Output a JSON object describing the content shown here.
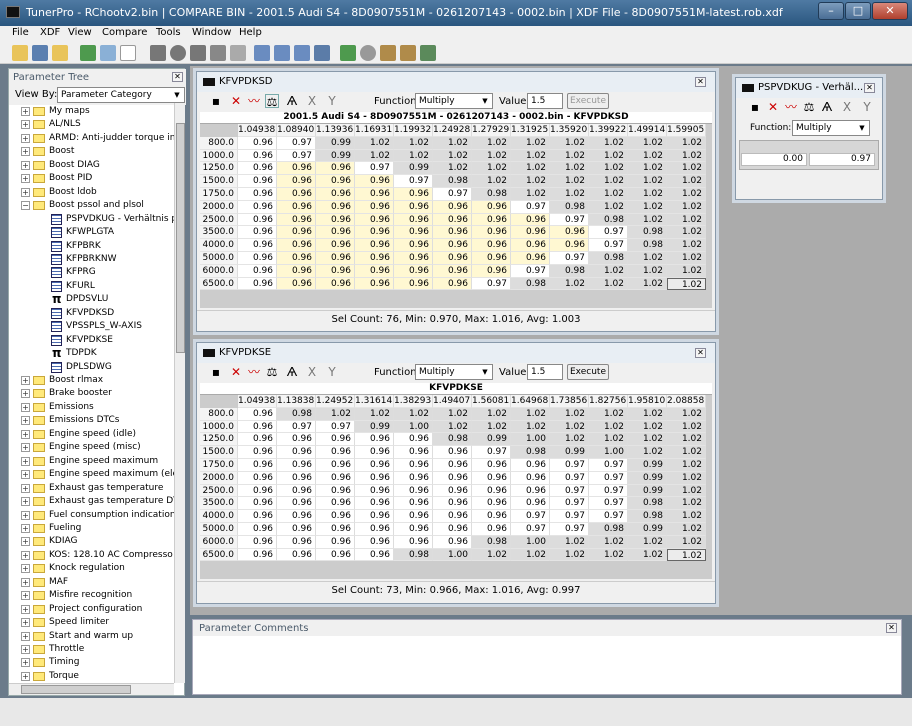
{
  "app": {
    "title": "TunerPro - RChootv2.bin | COMPARE BIN - 2001.5 Audi S4 - 8D0907551M - 0261207143 - 0002.bin | XDF File - 8D0907551M-latest.rob.xdf"
  },
  "menu": [
    "File",
    "XDF",
    "View",
    "Compare",
    "Tools",
    "Window",
    "Help"
  ],
  "tree": {
    "header": "Parameter Tree",
    "viewby_label": "View By:",
    "viewby_value": "Parameter Category",
    "items": [
      {
        "label": "My maps",
        "kind": "folder"
      },
      {
        "label": "AL/NLS",
        "kind": "folder"
      },
      {
        "label": "ARMD: Anti-judder torque inte",
        "kind": "folder"
      },
      {
        "label": "Boost",
        "kind": "folder"
      },
      {
        "label": "Boost DIAG",
        "kind": "folder"
      },
      {
        "label": "Boost PID",
        "kind": "folder"
      },
      {
        "label": "Boost ldob",
        "kind": "folder"
      },
      {
        "label": "Boost pssol and plsol",
        "kind": "folder-open"
      },
      {
        "label": "PSPVDKUG - Verhältnis psp",
        "kind": "table"
      },
      {
        "label": "KFWPLGTA",
        "kind": "table"
      },
      {
        "label": "KFPBRK",
        "kind": "table"
      },
      {
        "label": "KFPBRKNW",
        "kind": "table"
      },
      {
        "label": "KFPRG",
        "kind": "table"
      },
      {
        "label": "KFURL",
        "kind": "table"
      },
      {
        "label": "DPDSVLU",
        "kind": "pi"
      },
      {
        "label": "KFVPDKSD",
        "kind": "table"
      },
      {
        "label": "VPSSPLS_W-AXIS",
        "kind": "table"
      },
      {
        "label": "KFVPDKSE",
        "kind": "table"
      },
      {
        "label": "TDPDK",
        "kind": "pi"
      },
      {
        "label": "DPLSDWG",
        "kind": "table"
      },
      {
        "label": "Boost rlmax",
        "kind": "folder"
      },
      {
        "label": "Brake booster",
        "kind": "folder"
      },
      {
        "label": "Emissions",
        "kind": "folder"
      },
      {
        "label": "Emissions DTCs",
        "kind": "folder"
      },
      {
        "label": "Engine speed (idle)",
        "kind": "folder"
      },
      {
        "label": "Engine speed (misc)",
        "kind": "folder"
      },
      {
        "label": "Engine speed maximum",
        "kind": "folder"
      },
      {
        "label": "Engine speed maximum (eleva",
        "kind": "folder"
      },
      {
        "label": "Exhaust gas temperature",
        "kind": "folder"
      },
      {
        "label": "Exhaust gas temperature DTC",
        "kind": "folder"
      },
      {
        "label": "Fuel consumption indication",
        "kind": "folder"
      },
      {
        "label": "Fueling",
        "kind": "folder"
      },
      {
        "label": "KDIAG",
        "kind": "folder"
      },
      {
        "label": "KOS: 128.10   AC Compresso",
        "kind": "folder"
      },
      {
        "label": "Knock regulation",
        "kind": "folder"
      },
      {
        "label": "MAF",
        "kind": "folder"
      },
      {
        "label": "Misfire recognition",
        "kind": "folder"
      },
      {
        "label": "Project configuration",
        "kind": "folder"
      },
      {
        "label": "Speed limiter",
        "kind": "folder"
      },
      {
        "label": "Start and warm up",
        "kind": "folder"
      },
      {
        "label": "Throttle",
        "kind": "folder"
      },
      {
        "label": "Timing",
        "kind": "folder"
      },
      {
        "label": "Torque",
        "kind": "folder"
      }
    ]
  },
  "w1": {
    "title": "KFVPDKSD",
    "function_label": "Function:",
    "function_value": "Multiply",
    "value_label": "Value:",
    "value": "1.5",
    "execute": "Execute",
    "grid_title": "2001.5 Audi S4 - 8D0907551M - 0261207143 - 0002.bin - KFVPDKSD",
    "cols": [
      "1.04938",
      "1.08940",
      "1.13936",
      "1.16931",
      "1.19932",
      "1.24928",
      "1.27929",
      "1.31925",
      "1.35920",
      "1.39922",
      "1.49914",
      "1.59905"
    ],
    "rows": [
      "800.0",
      "1000.0",
      "1250.0",
      "1500.0",
      "1750.0",
      "2000.0",
      "2500.0",
      "3500.0",
      "4000.0",
      "5000.0",
      "6000.0",
      "6500.0"
    ],
    "data": [
      [
        "0.96",
        "0.97",
        "0.99",
        "1.02",
        "1.02",
        "1.02",
        "1.02",
        "1.02",
        "1.02",
        "1.02",
        "1.02",
        "1.02"
      ],
      [
        "0.96",
        "0.97",
        "0.99",
        "1.02",
        "1.02",
        "1.02",
        "1.02",
        "1.02",
        "1.02",
        "1.02",
        "1.02",
        "1.02"
      ],
      [
        "0.96",
        "0.96",
        "0.96",
        "0.97",
        "0.99",
        "1.02",
        "1.02",
        "1.02",
        "1.02",
        "1.02",
        "1.02",
        "1.02"
      ],
      [
        "0.96",
        "0.96",
        "0.96",
        "0.96",
        "0.97",
        "0.98",
        "1.02",
        "1.02",
        "1.02",
        "1.02",
        "1.02",
        "1.02"
      ],
      [
        "0.96",
        "0.96",
        "0.96",
        "0.96",
        "0.96",
        "0.97",
        "0.98",
        "1.02",
        "1.02",
        "1.02",
        "1.02",
        "1.02"
      ],
      [
        "0.96",
        "0.96",
        "0.96",
        "0.96",
        "0.96",
        "0.96",
        "0.96",
        "0.97",
        "0.98",
        "1.02",
        "1.02",
        "1.02"
      ],
      [
        "0.96",
        "0.96",
        "0.96",
        "0.96",
        "0.96",
        "0.96",
        "0.96",
        "0.96",
        "0.97",
        "0.98",
        "1.02",
        "1.02"
      ],
      [
        "0.96",
        "0.96",
        "0.96",
        "0.96",
        "0.96",
        "0.96",
        "0.96",
        "0.96",
        "0.96",
        "0.97",
        "0.98",
        "1.02"
      ],
      [
        "0.96",
        "0.96",
        "0.96",
        "0.96",
        "0.96",
        "0.96",
        "0.96",
        "0.96",
        "0.96",
        "0.97",
        "0.98",
        "1.02"
      ],
      [
        "0.96",
        "0.96",
        "0.96",
        "0.96",
        "0.96",
        "0.96",
        "0.96",
        "0.96",
        "0.97",
        "0.98",
        "1.02",
        "1.02"
      ],
      [
        "0.96",
        "0.96",
        "0.96",
        "0.96",
        "0.96",
        "0.96",
        "0.96",
        "0.97",
        "0.98",
        "1.02",
        "1.02",
        "1.02"
      ],
      [
        "0.96",
        "0.96",
        "0.96",
        "0.96",
        "0.96",
        "0.96",
        "0.97",
        "0.98",
        "1.02",
        "1.02",
        "1.02",
        "1.02"
      ]
    ],
    "status": "Sel Count: 76, Min: 0.970, Max: 1.016, Avg: 1.003"
  },
  "w2": {
    "title": "KFVPDKSE",
    "function_label": "Function:",
    "function_value": "Multiply",
    "value_label": "Value:",
    "value": "1.5",
    "execute": "Execute",
    "grid_title": "KFVPDKSE",
    "cols": [
      "1.04938",
      "1.13838",
      "1.24952",
      "1.31614",
      "1.38293",
      "1.49407",
      "1.56081",
      "1.64968",
      "1.73856",
      "1.82756",
      "1.95810",
      "2.08858"
    ],
    "rows": [
      "800.0",
      "1000.0",
      "1250.0",
      "1500.0",
      "1750.0",
      "2000.0",
      "2500.0",
      "3500.0",
      "4000.0",
      "5000.0",
      "6000.0",
      "6500.0"
    ],
    "data": [
      [
        "0.96",
        "0.98",
        "1.02",
        "1.02",
        "1.02",
        "1.02",
        "1.02",
        "1.02",
        "1.02",
        "1.02",
        "1.02",
        "1.02"
      ],
      [
        "0.96",
        "0.97",
        "0.97",
        "0.99",
        "1.00",
        "1.02",
        "1.02",
        "1.02",
        "1.02",
        "1.02",
        "1.02",
        "1.02"
      ],
      [
        "0.96",
        "0.96",
        "0.96",
        "0.96",
        "0.96",
        "0.98",
        "0.99",
        "1.00",
        "1.02",
        "1.02",
        "1.02",
        "1.02"
      ],
      [
        "0.96",
        "0.96",
        "0.96",
        "0.96",
        "0.96",
        "0.96",
        "0.97",
        "0.98",
        "0.99",
        "1.00",
        "1.02",
        "1.02"
      ],
      [
        "0.96",
        "0.96",
        "0.96",
        "0.96",
        "0.96",
        "0.96",
        "0.96",
        "0.96",
        "0.97",
        "0.97",
        "0.99",
        "1.02"
      ],
      [
        "0.96",
        "0.96",
        "0.96",
        "0.96",
        "0.96",
        "0.96",
        "0.96",
        "0.96",
        "0.97",
        "0.97",
        "0.99",
        "1.02"
      ],
      [
        "0.96",
        "0.96",
        "0.96",
        "0.96",
        "0.96",
        "0.96",
        "0.96",
        "0.96",
        "0.97",
        "0.97",
        "0.99",
        "1.02"
      ],
      [
        "0.96",
        "0.96",
        "0.96",
        "0.96",
        "0.96",
        "0.96",
        "0.96",
        "0.96",
        "0.97",
        "0.97",
        "0.98",
        "1.02"
      ],
      [
        "0.96",
        "0.96",
        "0.96",
        "0.96",
        "0.96",
        "0.96",
        "0.96",
        "0.97",
        "0.97",
        "0.97",
        "0.98",
        "1.02"
      ],
      [
        "0.96",
        "0.96",
        "0.96",
        "0.96",
        "0.96",
        "0.96",
        "0.96",
        "0.97",
        "0.97",
        "0.98",
        "0.99",
        "1.02"
      ],
      [
        "0.96",
        "0.96",
        "0.96",
        "0.96",
        "0.96",
        "0.96",
        "0.98",
        "1.00",
        "1.02",
        "1.02",
        "1.02",
        "1.02"
      ],
      [
        "0.96",
        "0.96",
        "0.96",
        "0.96",
        "0.98",
        "1.00",
        "1.02",
        "1.02",
        "1.02",
        "1.02",
        "1.02",
        "1.02"
      ]
    ],
    "status": "Sel Count: 73, Min: 0.966, Max: 1.016, Avg: 0.997"
  },
  "w3": {
    "title": "PSPVDKUG - Verhäl...",
    "function_label": "Function:",
    "function_value": "Multiply",
    "val_left": "0.00",
    "val_right": "0.97"
  },
  "comments": {
    "title": "Parameter Comments"
  },
  "colors": {
    "yellow": "#fff8d2",
    "gray": "#dcdcdc",
    "white": "#ffffff",
    "accent": "#2a567f"
  }
}
